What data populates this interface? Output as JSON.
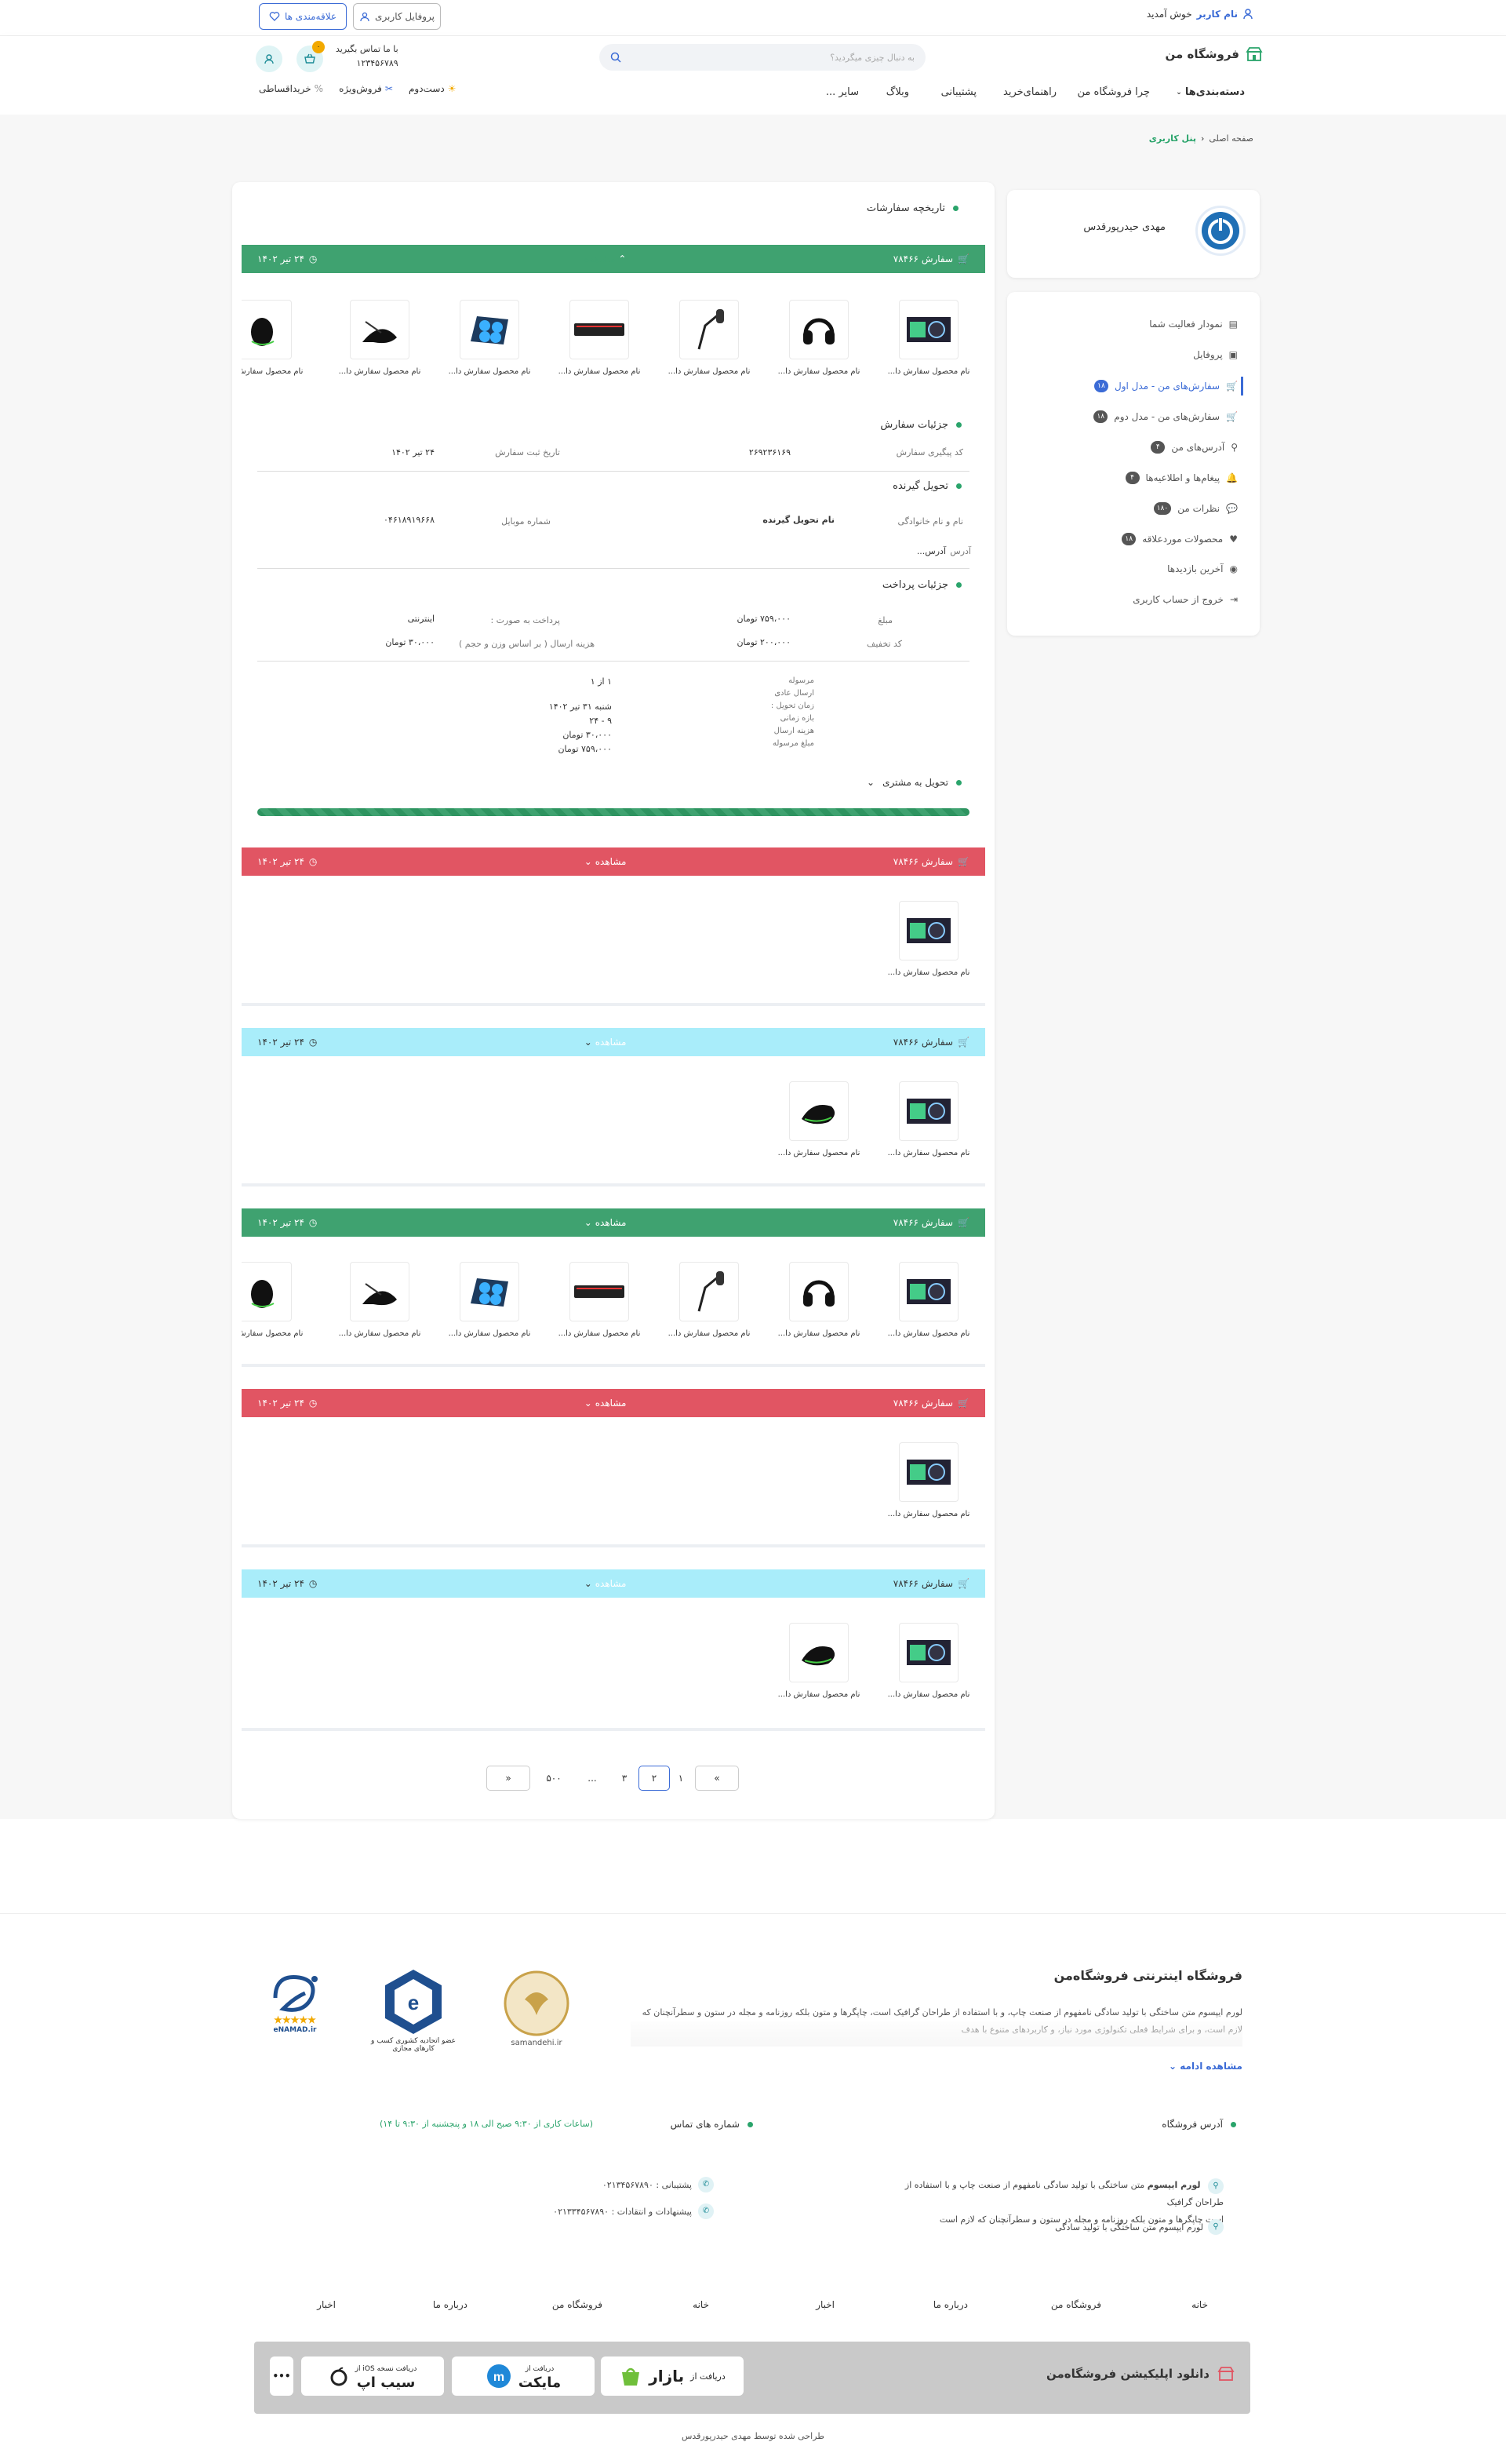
{
  "topbar": {
    "welcome_name": "نام کاربر",
    "welcome_rest": "خوش آمدید",
    "favorites_label": "علاقه‌مندی ها",
    "profile_label": "پروفایل کاربری"
  },
  "header": {
    "brand": "فروشگاه من",
    "search_placeholder": "به دنبال چیزی میگردید؟",
    "contact_title": "با ما تماس بگیرید",
    "contact_phone": "۱۲۳۴۵۶۷۸۹",
    "cart_count": "۰",
    "nav": [
      "دسته‌بندی‌ها",
      "چرا فروشگاه من",
      "راهنمای‌خرید",
      "پشتیبانی",
      "وبلاگ",
      "سایر ..."
    ],
    "promos": [
      "خریداقساطی",
      "فروش‌ویژه",
      "دست‌دوم"
    ]
  },
  "breadcrumb": {
    "home": "صفحه اصلی",
    "current": "پنل کاربری"
  },
  "sidebar": {
    "user_name": "مهدی حیدرپورقدس",
    "items": [
      {
        "label": "نمودار فعالیت شما",
        "badge": ""
      },
      {
        "label": "پروفایل",
        "badge": ""
      },
      {
        "label": "سفارش‌های من - مدل اول",
        "badge": "۱۸"
      },
      {
        "label": "سفارش‌های من - مدل دوم",
        "badge": "۱۸"
      },
      {
        "label": "آدرس‌های من",
        "badge": "۴"
      },
      {
        "label": "پیغام‌ها و اطلاعیه‌ها",
        "badge": "۴"
      },
      {
        "label": "نظرات من",
        "badge": "۱۸۰"
      },
      {
        "label": "محصولات موردعلاقه",
        "badge": "۱۸"
      },
      {
        "label": "آخرین بازدیدها",
        "badge": ""
      },
      {
        "label": "خروج از حساب کاربری",
        "badge": ""
      }
    ]
  },
  "orders": {
    "title": "تاریخچه سفارشات",
    "order_label": "سفارش ۷۸۴۶۶",
    "date": "۲۴ تیر ۱۴۰۲",
    "view_label": "مشاهده",
    "product_name": "نام محصول سفارش دا..."
  },
  "details": {
    "order_details_title": "جزئیات سفارش",
    "tracking_label": "کد پیگیری سفارش",
    "tracking_value": "۲۶۹۲۳۶۱۶۹",
    "reg_date_label": "تاریخ ثبت سفارش",
    "reg_date_value": "۲۴ تیر ۱۴۰۲",
    "receiver_title": "تحویل گیرنده",
    "fullname_label": "نام و نام خانوادگی",
    "fullname_value": "نام تحویل گیرنده",
    "mobile_label": "شماره موبایل",
    "mobile_value": "۰۴۶۱۸۹۱۹۶۶۸",
    "address_label": "آدرس",
    "address_value": "آدرس...",
    "payment_title": "جزئیات پرداخت",
    "amount_label": "مبلغ",
    "amount_value": "۷۵۹،۰۰۰ تومان",
    "pay_type_label": "پرداخت به صورت :",
    "pay_type_value": "اینترنتی",
    "discount_label": "کد تخفیف",
    "discount_value": "۲۰۰،۰۰۰ تومان",
    "shipping_label": "هزینه ارسال ( بر اساس وزن و حجم )",
    "shipping_value": "۳۰،۰۰۰ تومان",
    "shipment_labels": [
      "مرسوله",
      "ارسال عادی",
      "زمان تحویل :",
      "بازه زمانی",
      "هزینه ارسال",
      "مبلغ مرسوله"
    ],
    "shipment_values": [
      "۱ از ۱",
      "شنبه ۳۱ تیر ۱۴۰۲",
      "۹ - ۲۴",
      "۳۰،۰۰۰ تومان",
      "۷۵۹،۰۰۰ تومان"
    ],
    "delivered_label": "تحویل به مشتری",
    "progress": 1.0
  },
  "pagination": [
    "»",
    "۱",
    "۲",
    "۳",
    "...",
    "۵۰۰",
    "«"
  ],
  "footer": {
    "store_title": "فروشگاه اینترنتی فروشگاه‌من",
    "description": "لورم ایپسوم متن ساختگی با تولید سادگی نامفهوم از صنعت چاپ، و با استفاده از طراحان گرافیک است، چاپگرها و متون بلکه روزنامه و مجله در ستون و سطرآنچنان که لازم است، و برای شرایط فعلی تکنولوژی مورد نیاز، و کاربردهای متنوع با هدف",
    "read_more": "مشاهده ادامه",
    "address_title": "آدرس فروشگاه",
    "phone_title": "شماره های تماس",
    "phone_hours": "(ساعات کاری از ۹:۳۰ صبح الی ۱۸ و پنجشنبه از ۹:۳۰ تا ۱۴)",
    "address_line1_bold": "لورم ایپسوم",
    "address_line1": "متن ساختگی با تولید سادگی نامفهوم از صنعت چاپ و با استفاده از طراحان گرافیک",
    "address_line2": "است چاپگرها و متون بلکه روزنامه و مجله در ستون و سطرآنچنان که لازم است",
    "address_line3": "لورم ایپسوم متن ساختگی با تولید سادگی",
    "support_phone": "پشتیبانی : ۰۲۱۳۴۵۶۷۸۹۰",
    "feedback_phone": "پیشنهادات و انتقادات : ۰۲۱۳۳۴۵۶۷۸۹۰",
    "badges": [
      "samandehi.ir",
      "عضو اتحادیه کشوری کسب و کارهای مجازی",
      "eNAMAD.ir"
    ],
    "links": [
      "خانه",
      "فروشگاه من",
      "درباره ما",
      "اخبار",
      "خانه",
      "فروشگاه من",
      "درباره ما",
      "اخبار"
    ],
    "app_title": "دانلود اپلیکیشن فروشگاه‌من",
    "bazaar_pre": "دریافت از",
    "bazaar": "بازار",
    "myket_pre": "دریافت از",
    "myket": "مایکت",
    "sibapp_pre": "دریافت نسخه iOS از",
    "sibapp": "سیب اپ",
    "more": "•••",
    "credit": "طراحی شده توسط مهدی حیدرپورقدس"
  },
  "colors": {
    "green": "#3fa270",
    "red": "#e15563",
    "cyan": "#a9edfa",
    "accent": "#3b6bd6",
    "brand_green": "#2aa46b"
  }
}
